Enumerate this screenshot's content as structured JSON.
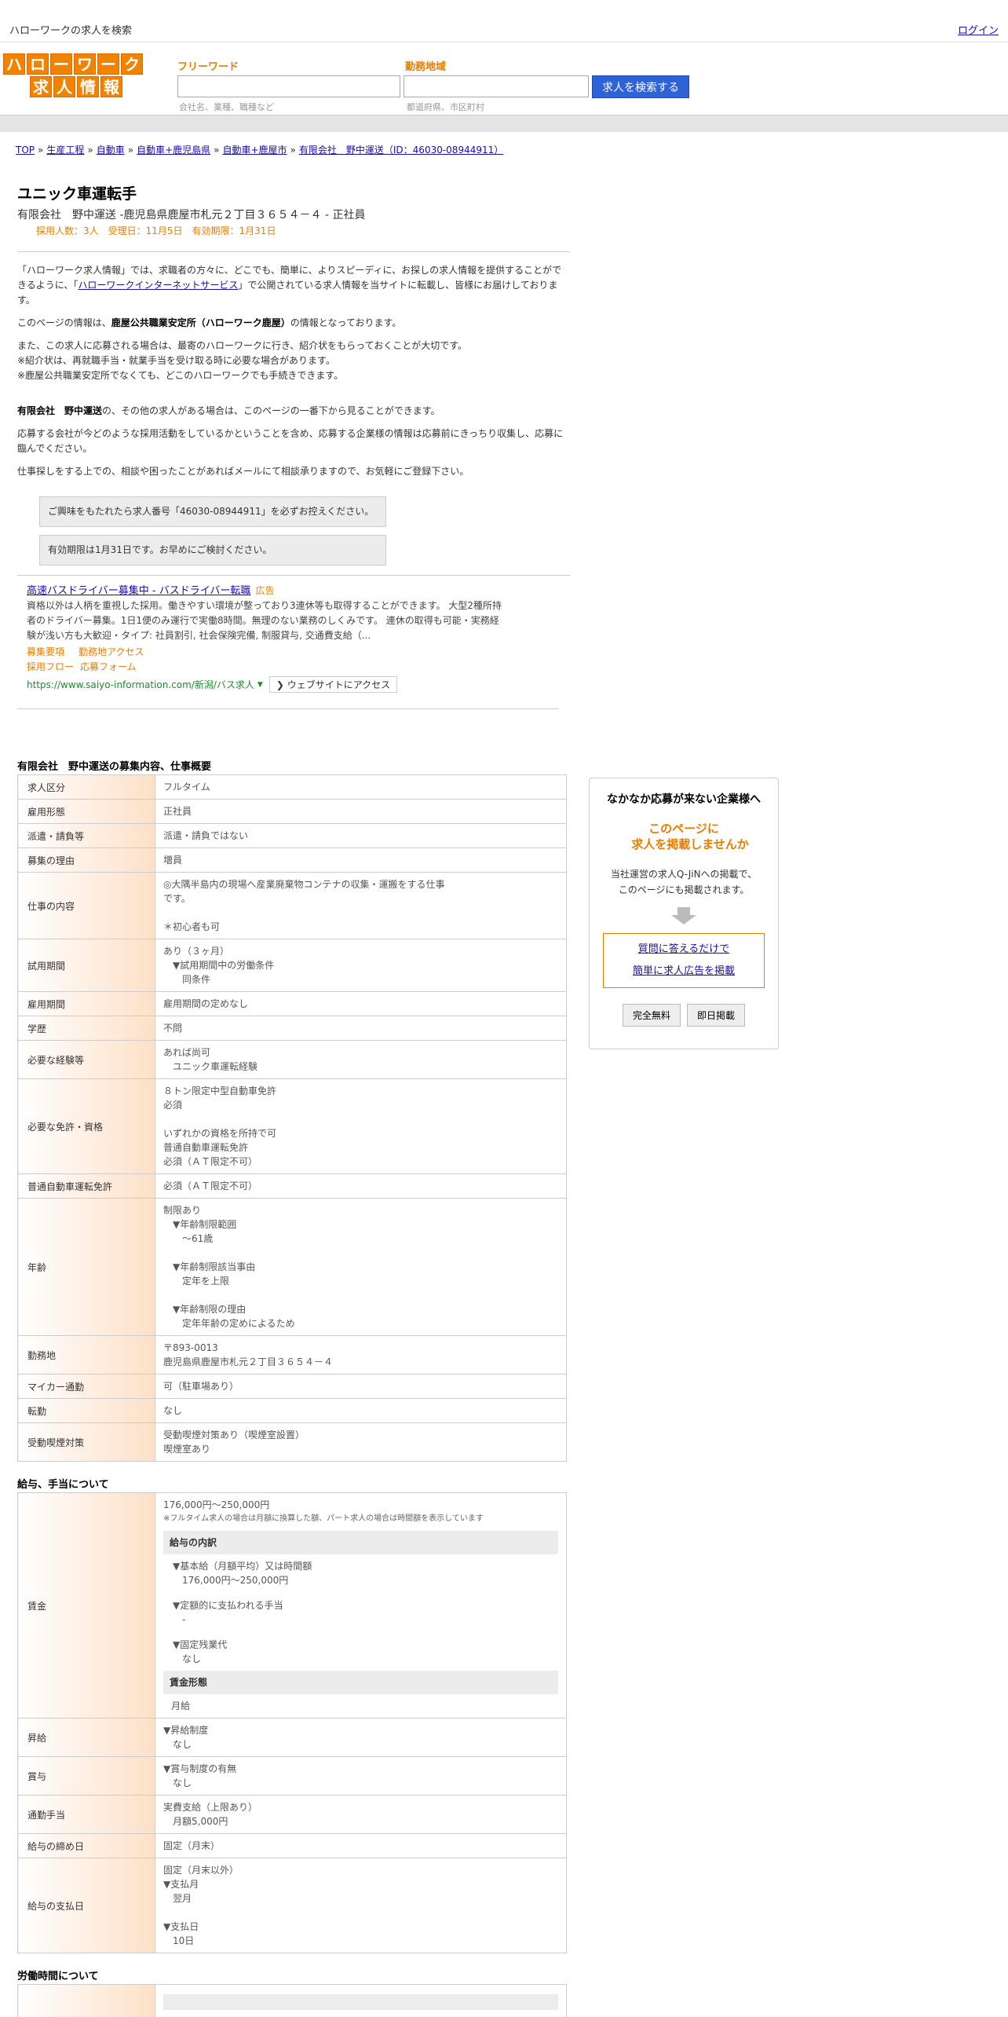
{
  "topbar": {
    "site_title": "ハローワークの求人を検索",
    "login": "ログイン"
  },
  "logo": {
    "row1": [
      "ハ",
      "ロ",
      "ー",
      "ワ",
      "ー",
      "ク"
    ],
    "row2": [
      "求",
      "人",
      "情",
      "報"
    ]
  },
  "search": {
    "freeword_label": "フリーワード",
    "freeword_hint": "会社名、業種、職種など",
    "area_label": "勤務地域",
    "area_hint": "都道府県、市区町村",
    "button": "求人を検索する"
  },
  "breadcrumb": [
    "TOP",
    "生産工程",
    "自動車",
    "自動車+鹿児島県",
    "自動車+鹿屋市",
    "有限会社　野中運送（ID：46030-08944911）"
  ],
  "job": {
    "title": "ユニック車運転手",
    "company_line": "有限会社　野中運送 -鹿児島県鹿屋市札元２丁目３６５４－４ - 正社員",
    "meta": "採用人数：3人　受理日：11月5日　有効期限：1月31日"
  },
  "intro": {
    "p1_a": "「ハローワーク求人情報」では、求職者の方々に、どこでも、簡単に、よりスピーディに、お探しの求人情報を提供することができるように、「",
    "p1_link": "ハローワークインターネットサービス",
    "p1_b": "」で公開されている求人情報を当サイトに転載し、皆様にお届けしております。",
    "p2_a": "このページの情報は、",
    "p2_bold": "鹿屋公共職業安定所（ハローワーク鹿屋）",
    "p2_b": "の情報となっております。",
    "p3_l1": "また、この求人に応募される場合は、最寄のハローワークに行き、紹介状をもらっておくことが大切です。",
    "p3_l2": "※紹介状は、再就職手当・就業手当を受け取る時に必要な場合があります。",
    "p3_l3": "※鹿屋公共職業安定所でなくても、どこのハローワークでも手続きできます。",
    "p4_bold": "有限会社　野中運送",
    "p4_b": "の、その他の求人がある場合は、このページの一番下から見ることができます。",
    "p5": "応募する会社が今どのような採用活動をしているかということを含め、応募する企業様の情報は応募前にきっちり収集し、応募に臨んでください。",
    "p6": "仕事探しをする上での、相談や困ったことがあればメールにて相談承りますので、お気軽にご登録下さい。",
    "notice1": "ご興味をもたれたら求人番号「46030-08944911」を必ずお控えください。",
    "notice2": "有効期限は1月31日です。お早めにご検討ください。"
  },
  "ad": {
    "title": "高速バスドライバー募集中 - バスドライバー転職",
    "badge": "広告",
    "desc": "資格以外は人柄を重視した採用。働きやすい環境が整っており3連休等も取得することができます。 大型2種所持者のドライバー募集。1日1便のみ運行で実働8時間。無理のない業務のしくみです。 連休の取得も可能・実務経験が浅い方も大歓迎・タイプ: 社員割引, 社会保険完備, 制服貸与, 交通費支給（...",
    "links": [
      "募集要項",
      "勤務地アクセス",
      "採用フロー",
      "応募フォーム"
    ],
    "url": "https://www.saiyo-information.com/新潟/バス求人",
    "visit": "❯ ウェブサイトにアクセス"
  },
  "overview": {
    "title": "有限会社　野中運送の募集内容、仕事概要",
    "rows": [
      {
        "k": "求人区分",
        "v": [
          "フルタイム"
        ]
      },
      {
        "k": "雇用形態",
        "v": [
          "正社員"
        ]
      },
      {
        "k": "派遣・請負等",
        "v": [
          "派遣・請負ではない"
        ]
      },
      {
        "k": "募集の理由",
        "v": [
          "増員"
        ]
      },
      {
        "k": "仕事の内容",
        "v": [
          "◎大隅半島内の現場へ産業廃棄物コンテナの収集・運搬をする仕事",
          "です。",
          "",
          "＊初心者も可"
        ]
      },
      {
        "k": "試用期間",
        "v": [
          "あり（３ヶ月）",
          "　▼試用期間中の労働条件",
          "　　同条件"
        ]
      },
      {
        "k": "雇用期間",
        "v": [
          "雇用期間の定めなし"
        ]
      },
      {
        "k": "学歴",
        "v": [
          "不問"
        ]
      },
      {
        "k": "必要な経験等",
        "v": [
          "あれば尚可",
          "　ユニック車運転経験"
        ]
      },
      {
        "k": "必要な免許・資格",
        "v": [
          "８トン限定中型自動車免許",
          "必須",
          "",
          "いずれかの資格を所持で可",
          "普通自動車運転免許",
          "必須（ＡＴ限定不可）"
        ]
      },
      {
        "k": "普通自動車運転免許",
        "v": [
          "必須（ＡＴ限定不可）"
        ]
      },
      {
        "k": "年齢",
        "v": [
          "制限あり",
          "　▼年齢制限範囲",
          "　　〜61歳",
          "",
          "　▼年齢制限該当事由",
          "　　定年を上限",
          "",
          "　▼年齢制限の理由",
          "　　定年年齢の定めによるため"
        ]
      },
      {
        "k": "勤務地",
        "v": [
          "〒893-0013",
          "鹿児島県鹿屋市札元２丁目３６５４－４"
        ]
      },
      {
        "k": "マイカー通勤",
        "v": [
          "可（駐車場あり）"
        ]
      },
      {
        "k": "転勤",
        "v": [
          "なし"
        ]
      },
      {
        "k": "受動喫煙対策",
        "v": [
          "受動喫煙対策あり（喫煙室設置）",
          "喫煙室あり"
        ]
      }
    ]
  },
  "salary": {
    "title": "給与、手当について",
    "wage_key": "賃金",
    "wage_range": "176,000円〜250,000円",
    "wage_note": "※フルタイム求人の場合は月額に換算した額、パート求人の場合は時間額を表示しています",
    "breakdown_head": "給与の内訳",
    "breakdown": [
      "▼基本給（月額平均）又は時間額",
      "　176,000円〜250,000円",
      "",
      "▼定額的に支払われる手当",
      "　-",
      "",
      "▼固定残業代",
      "　なし"
    ],
    "form_head": "賃金形態",
    "form_value": "月給",
    "rows": [
      {
        "k": "昇給",
        "v": [
          "▼昇給制度",
          "　なし"
        ]
      },
      {
        "k": "賞与",
        "v": [
          "▼賞与制度の有無",
          "　なし"
        ]
      },
      {
        "k": "通勤手当",
        "v": [
          "実費支給（上限あり）",
          "　月額5,000円"
        ]
      },
      {
        "k": "給与の締め日",
        "v": [
          "固定（月末）"
        ]
      },
      {
        "k": "給与の支払日",
        "v": [
          "固定（月末以外）",
          "▼支払月",
          "　翌月",
          "",
          "▼支払日",
          "　10日"
        ]
      }
    ]
  },
  "hours": {
    "title": "労働時間について"
  },
  "sidebar": {
    "title": "なかなか応募が来ない企業様へ",
    "catch1": "このページに",
    "catch2": "求人を掲載しませんか",
    "text1": "当社運営の求人Q-JiNへの掲載で、",
    "text2": "このページにも掲載されます。",
    "link1": "質問に答えるだけで",
    "link2": "簡単に求人広告を掲載",
    "btn1": "完全無料",
    "btn2": "即日掲載"
  }
}
